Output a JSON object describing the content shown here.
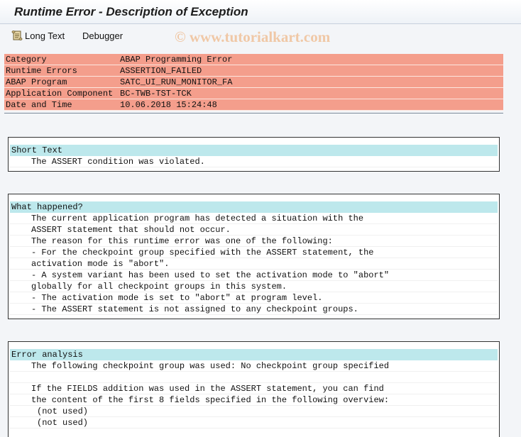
{
  "window": {
    "title": "Runtime Error - Description of Exception"
  },
  "toolbar": {
    "long_text_label": "Long Text",
    "debugger_label": "Debugger"
  },
  "watermark": "© www.tutorialkart.com",
  "header": {
    "rows": [
      {
        "key": "Category",
        "value": "ABAP Programming Error"
      },
      {
        "key": "Runtime Errors",
        "value": "ASSERTION_FAILED"
      },
      {
        "key": "ABAP Program",
        "value": "SATC_UI_RUN_MONITOR_FA"
      },
      {
        "key": "Application Component",
        "value": "BC-TWB-TST-TCK"
      },
      {
        "key": "Date and Time",
        "value": "10.06.2018 15:24:48"
      }
    ]
  },
  "short_text": {
    "title": "Short Text",
    "lines": [
      "The ASSERT condition was violated."
    ]
  },
  "what_happened": {
    "title": "What happened?",
    "lines": [
      "The current application program has detected a situation with the",
      "ASSERT statement that should not occur.",
      "The reason for this runtime error was one of the following:",
      "- For the checkpoint group specified with the ASSERT statement, the",
      "activation mode is \"abort\".",
      "- A system variant has been used to set the activation mode to \"abort\"",
      "globally for all checkpoint groups in this system.",
      "- The activation mode is set to \"abort\" at program level.",
      "- The ASSERT statement is not assigned to any checkpoint groups."
    ]
  },
  "error_analysis": {
    "title": "Error analysis",
    "lines": [
      "The following checkpoint group was used: No checkpoint group specified",
      "",
      "If the FIELDS addition was used in the ASSERT statement, you can find",
      "the content of the first 8 fields specified in the following overview:"
    ],
    "sub_lines": [
      "(not used)",
      "(not used)"
    ]
  }
}
